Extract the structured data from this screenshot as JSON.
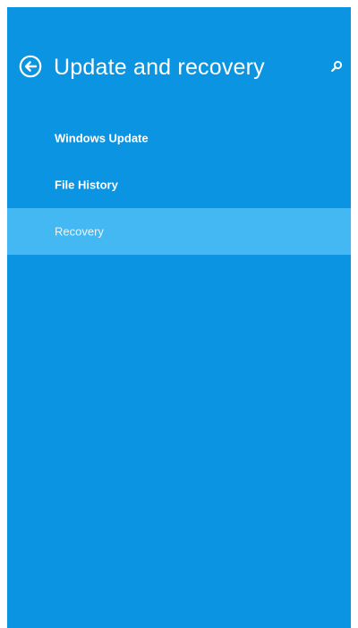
{
  "header": {
    "title": "Update and recovery",
    "back_icon": "back-arrow-circle-icon",
    "search_icon": "search-icon"
  },
  "nav": {
    "items": [
      {
        "label": "Windows Update",
        "selected": false
      },
      {
        "label": "File History",
        "selected": false
      },
      {
        "label": "Recovery",
        "selected": true
      }
    ]
  },
  "colors": {
    "background": "#0a94e1",
    "selected": "#43b8f2",
    "text": "#ffffff"
  }
}
